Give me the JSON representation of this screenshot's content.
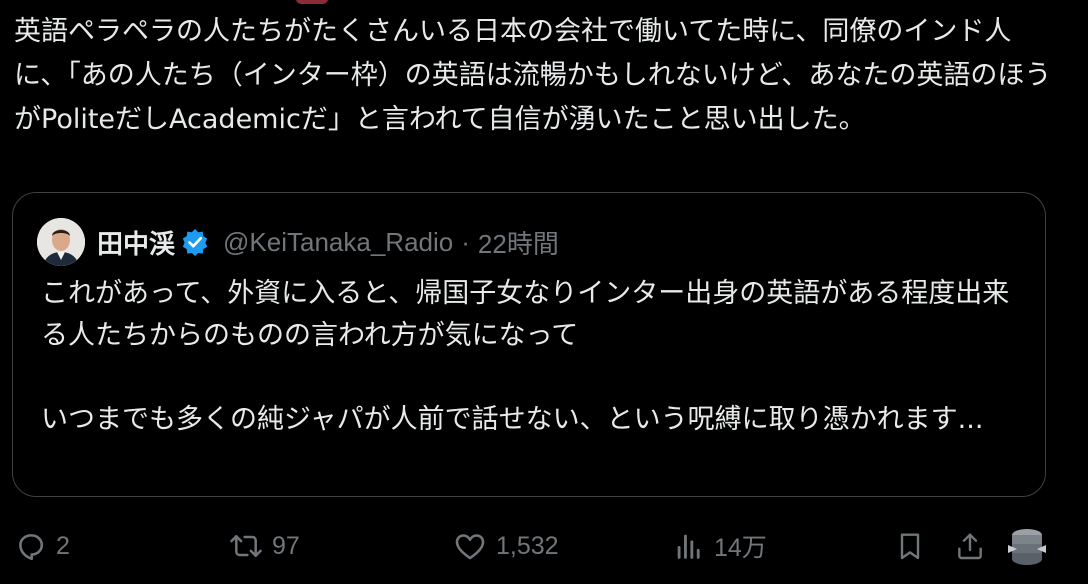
{
  "tweet": {
    "text": "英語ペラペラの人たちがたくさんいる日本の会社で働いてた時に、同僚のインド人に、「あの人たち（インター枠）の英語は流暢かもしれないけど、あなたの英語のほうがPoliteだしAcademicだ」と言われて自信が湧いたこと思い出した。"
  },
  "quote": {
    "author_name": "田中渓",
    "handle": "@KeiTanaka_Radio",
    "separator": "·",
    "time": "22時間",
    "text": "これがあって、外資に入ると、帰国子女なりインター出身の英語がある程度出来る人たちからのものの言われ方が気になって\n\nいつまでも多くの純ジャパが人前で話せない、という呪縛に取り憑かれます..."
  },
  "actions": {
    "reply_count": "2",
    "repost_count": "97",
    "like_count": "1,532",
    "view_count": "14万"
  },
  "icons": {
    "reply": "reply-icon",
    "repost": "repost-icon",
    "like": "heart-icon",
    "views": "views-icon",
    "bookmark": "bookmark-icon",
    "share": "share-icon",
    "extension": "stack-icon"
  },
  "colors": {
    "background": "#000000",
    "text": "#e7e9ea",
    "muted": "#71767b",
    "border": "#3e4144",
    "verified": "#1d9bf0"
  }
}
